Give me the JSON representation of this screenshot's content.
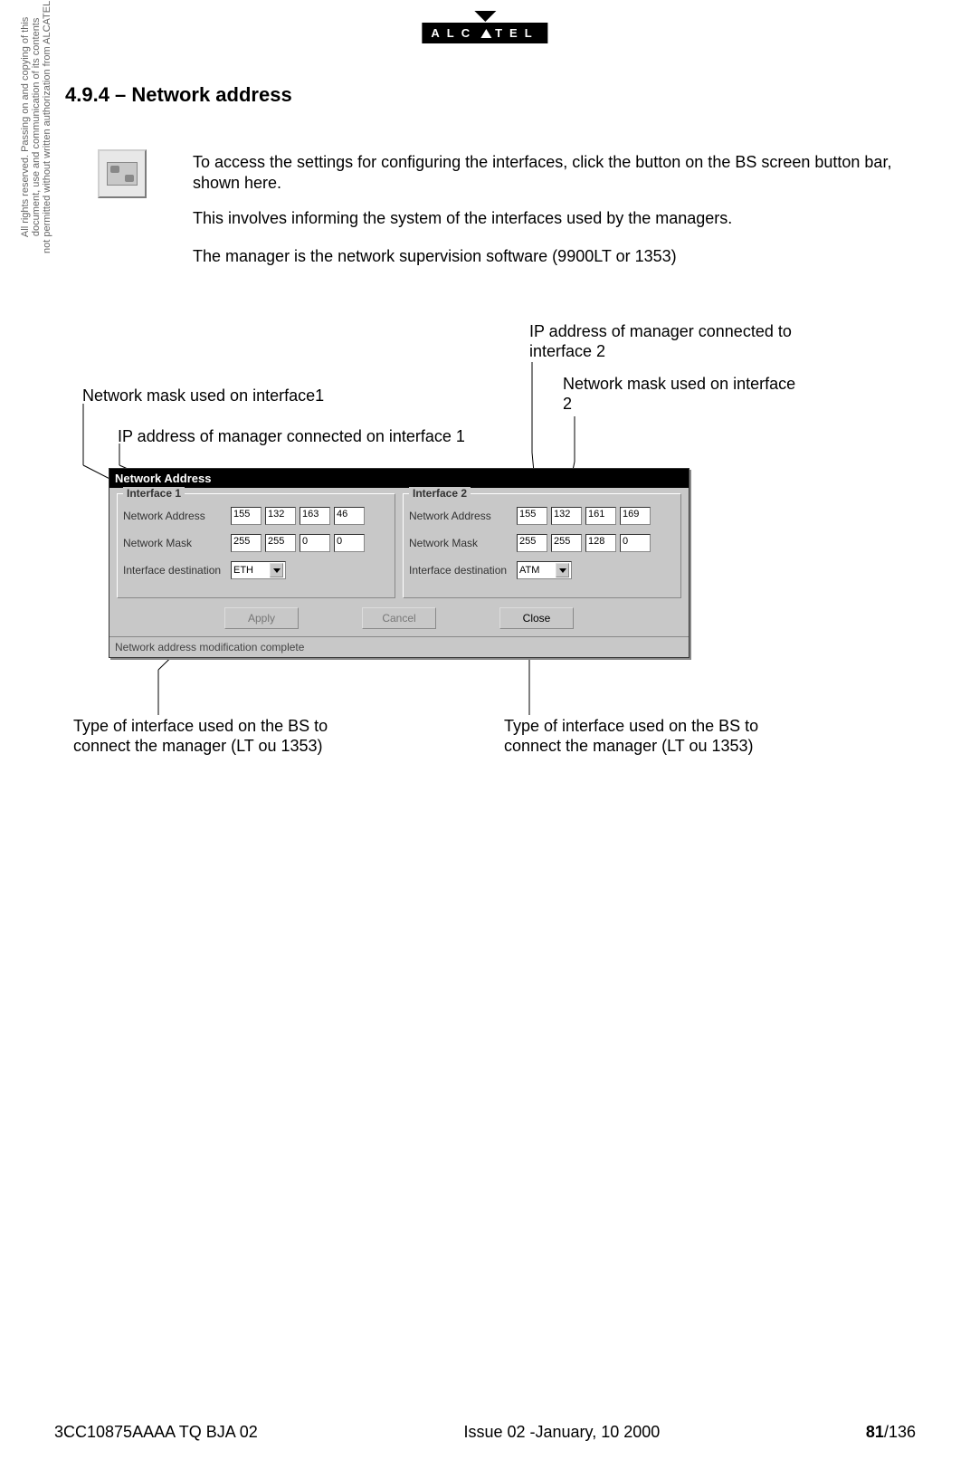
{
  "logo_text_left": "ALC",
  "logo_text_right": "TEL",
  "heading": "4.9.4 – Network address",
  "vertical_notice_l1": "All rights reserved. Passing on and copying of this",
  "vertical_notice_l2": "document, use and communication of its contents",
  "vertical_notice_l3": "not permitted without written authorization from ALCATEL",
  "para1": "To access the settings for configuring the interfaces, click the button on the BS screen button bar, shown here.",
  "para2": "This involves informing the system of the interfaces used by the managers.",
  "para3": "The manager is the network supervision software (9900LT or 1353)",
  "annotations": {
    "ip_if2": "IP address of manager connected to interface 2",
    "mask_if2": "Network mask used on interface 2",
    "mask_if1": "Network mask used on interface1",
    "ip_if1": "IP address of manager connected on interface 1",
    "type_if1": "Type of interface used on the BS to connect the manager (LT ou 1353)",
    "type_if2": "Type of interface used on the BS to connect the manager (LT ou 1353)"
  },
  "dialog": {
    "title": "Network Address",
    "interface1": {
      "title": "Interface 1",
      "addr_label": "Network Address",
      "addr": [
        "155",
        "132",
        "163",
        "46"
      ],
      "mask_label": "Network Mask",
      "mask": [
        "255",
        "255",
        "0",
        "0"
      ],
      "dest_label": "Interface destination",
      "dest": "ETH"
    },
    "interface2": {
      "title": "Interface 2",
      "addr_label": "Network Address",
      "addr": [
        "155",
        "132",
        "161",
        "169"
      ],
      "mask_label": "Network Mask",
      "mask": [
        "255",
        "255",
        "128",
        "0"
      ],
      "dest_label": "Interface destination",
      "dest": "ATM"
    },
    "btn_apply": "Apply",
    "btn_cancel": "Cancel",
    "btn_close": "Close",
    "status": "Network address modification complete"
  },
  "footer": {
    "left": "3CC10875AAAA TQ BJA 02",
    "center": "Issue 02 -January, 10 2000",
    "page_current": "81",
    "page_total": "/136"
  }
}
